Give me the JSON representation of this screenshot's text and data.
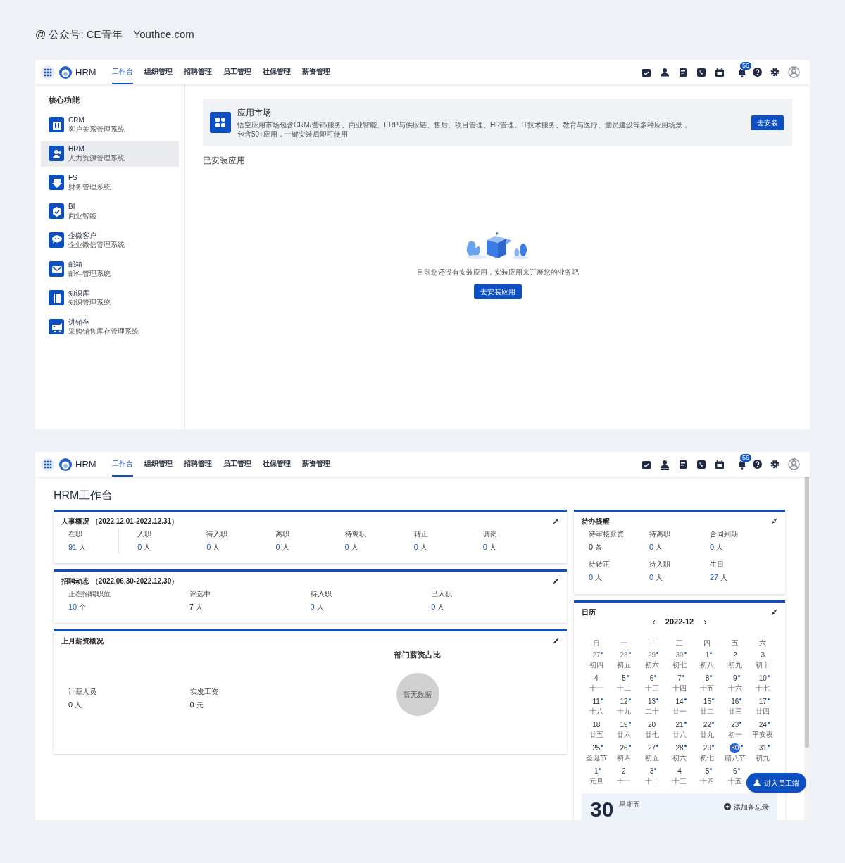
{
  "credit": [
    "@ 公众号: CE青年",
    "Youthce.com"
  ],
  "app_market_screen": {
    "nav": {
      "brand": "HRM",
      "tabs": [
        {
          "label": "工作台",
          "selected": true
        },
        {
          "label": "组织管理",
          "selected": false
        },
        {
          "label": "招聘管理",
          "selected": false
        },
        {
          "label": "员工管理",
          "selected": false
        },
        {
          "label": "社保管理",
          "selected": false
        },
        {
          "label": "薪资管理",
          "selected": false
        }
      ],
      "badge": "56"
    },
    "sidebar": {
      "heading": "核心功能",
      "items": [
        {
          "name": "CRM",
          "desc": "客户关系管理系统",
          "selected": false
        },
        {
          "name": "HRM",
          "desc": "人力资源管理系统",
          "selected": true
        },
        {
          "name": "FS",
          "desc": "财务管理系统",
          "selected": false
        },
        {
          "name": "BI",
          "desc": "商业智能",
          "selected": false
        },
        {
          "name": "企微客户",
          "desc": "企业微信管理系统",
          "selected": false
        },
        {
          "name": "邮箱",
          "desc": "邮件管理系统",
          "selected": false
        },
        {
          "name": "知识库",
          "desc": "知识管理系统",
          "selected": false
        },
        {
          "name": "进销存",
          "desc": "采购销售库存管理系统",
          "selected": false
        }
      ]
    },
    "market": {
      "title": "应用市场",
      "lines": [
        "悟空应用市场包含CRM/营销/服务、商业智能、ERP与供应链、售后、项目管理、HR管理、IT技术服务、教育与医疗、党员建设等多种应用场景，",
        "包含50+应用，一键安装后即可使用"
      ],
      "button": "去安装"
    },
    "installed": {
      "heading": "已安装应用",
      "empty_text": "目前您还没有安装应用，安装应用来开展您的业务吧",
      "button": "去安装应用"
    }
  },
  "workbench_screen": {
    "nav": {
      "brand": "HRM",
      "tabs": [
        {
          "label": "工作台",
          "selected": true
        },
        {
          "label": "组织管理",
          "selected": false
        },
        {
          "label": "招聘管理",
          "selected": false
        },
        {
          "label": "员工管理",
          "selected": false
        },
        {
          "label": "社保管理",
          "selected": false
        },
        {
          "label": "薪资管理",
          "selected": false
        }
      ],
      "badge": "56"
    },
    "title": "HRM工作台",
    "personnel": {
      "title": "人事概况 （2022.12.01-2022.12.31）",
      "stats": [
        {
          "label": "在职",
          "value": "91",
          "unit": "人",
          "accent": true
        },
        {
          "label": "入职",
          "value": "0",
          "unit": "人",
          "accent": true
        },
        {
          "label": "待入职",
          "value": "0",
          "unit": "人",
          "accent": true
        },
        {
          "label": "离职",
          "value": "0",
          "unit": "人",
          "accent": true
        },
        {
          "label": "待离职",
          "value": "0",
          "unit": "人",
          "accent": true
        },
        {
          "label": "转正",
          "value": "0",
          "unit": "人",
          "accent": true
        },
        {
          "label": "调岗",
          "value": "0",
          "unit": "人",
          "accent": true
        }
      ]
    },
    "recruiting": {
      "title": "招聘动态 （2022.06.30-2022.12.30）",
      "stats": [
        {
          "label": "正在招聘职位",
          "value": "10",
          "unit": "个",
          "accent": true
        },
        {
          "label": "评选中",
          "value": "7",
          "unit": "人",
          "accent": false
        },
        {
          "label": "待入职",
          "value": "0",
          "unit": "人",
          "accent": true
        },
        {
          "label": "已入职",
          "value": "0",
          "unit": "人",
          "accent": true
        }
      ]
    },
    "salary": {
      "title": "上月薪资概况",
      "stats": [
        {
          "label": "计薪人员",
          "value": "0",
          "unit": "人",
          "accent": false
        },
        {
          "label": "实发工资",
          "value": "0",
          "unit": "元",
          "accent": false
        }
      ],
      "chart_title": "部门薪资占比",
      "no_data": "暂无数据"
    },
    "todo": {
      "title": "待办提醒",
      "stats": [
        {
          "label": "待审核薪资",
          "value": "0",
          "unit": "条",
          "accent": false
        },
        {
          "label": "待离职",
          "value": "0",
          "unit": "人",
          "accent": true
        },
        {
          "label": "合同到期",
          "value": "0",
          "unit": "人",
          "accent": true
        },
        {
          "label": "待转正",
          "value": "0",
          "unit": "人",
          "accent": true
        },
        {
          "label": "待入职",
          "value": "0",
          "unit": "人",
          "accent": true
        },
        {
          "label": "生日",
          "value": "27",
          "unit": "人",
          "accent": true
        }
      ]
    },
    "calendar": {
      "title": "日历",
      "prev": "‹",
      "month": "2022-12",
      "next": "›",
      "weekdays": [
        "日",
        "一",
        "二",
        "三",
        "四",
        "五",
        "六"
      ],
      "weeks": [
        [
          {
            "day": "27",
            "lunar": "初四",
            "dot": true,
            "muted": true,
            "selected": false
          },
          {
            "day": "28",
            "lunar": "初五",
            "dot": true,
            "muted": true,
            "selected": false
          },
          {
            "day": "29",
            "lunar": "初六",
            "dot": true,
            "muted": true,
            "selected": false
          },
          {
            "day": "30",
            "lunar": "初七",
            "dot": true,
            "muted": true,
            "selected": false
          },
          {
            "day": "1",
            "lunar": "初八",
            "dot": true,
            "muted": false,
            "selected": false
          },
          {
            "day": "2",
            "lunar": "初九",
            "dot": false,
            "muted": false,
            "selected": false
          },
          {
            "day": "3",
            "lunar": "初十",
            "dot": false,
            "muted": false,
            "selected": false
          }
        ],
        [
          {
            "day": "4",
            "lunar": "十一",
            "dot": false,
            "muted": false,
            "selected": false
          },
          {
            "day": "5",
            "lunar": "十二",
            "dot": true,
            "muted": false,
            "selected": false
          },
          {
            "day": "6",
            "lunar": "十三",
            "dot": true,
            "muted": false,
            "selected": false
          },
          {
            "day": "7",
            "lunar": "十四",
            "dot": true,
            "muted": false,
            "selected": false
          },
          {
            "day": "8",
            "lunar": "十五",
            "dot": true,
            "muted": false,
            "selected": false
          },
          {
            "day": "9",
            "lunar": "十六",
            "dot": true,
            "muted": false,
            "selected": false
          },
          {
            "day": "10",
            "lunar": "十七",
            "dot": true,
            "muted": false,
            "selected": false
          }
        ],
        [
          {
            "day": "11",
            "lunar": "十八",
            "dot": true,
            "muted": false,
            "selected": false
          },
          {
            "day": "12",
            "lunar": "十九",
            "dot": true,
            "muted": false,
            "selected": false
          },
          {
            "day": "13",
            "lunar": "二十",
            "dot": true,
            "muted": false,
            "selected": false
          },
          {
            "day": "14",
            "lunar": "廿一",
            "dot": true,
            "muted": false,
            "selected": false
          },
          {
            "day": "15",
            "lunar": "廿二",
            "dot": true,
            "muted": false,
            "selected": false
          },
          {
            "day": "16",
            "lunar": "廿三",
            "dot": true,
            "muted": false,
            "selected": false
          },
          {
            "day": "17",
            "lunar": "廿四",
            "dot": true,
            "muted": false,
            "selected": false
          }
        ],
        [
          {
            "day": "18",
            "lunar": "廿五",
            "dot": false,
            "muted": false,
            "selected": false
          },
          {
            "day": "19",
            "lunar": "廿六",
            "dot": true,
            "muted": false,
            "selected": false
          },
          {
            "day": "20",
            "lunar": "廿七",
            "dot": false,
            "muted": false,
            "selected": false
          },
          {
            "day": "21",
            "lunar": "廿八",
            "dot": true,
            "muted": false,
            "selected": false
          },
          {
            "day": "22",
            "lunar": "廿九",
            "dot": true,
            "muted": false,
            "selected": false
          },
          {
            "day": "23",
            "lunar": "初一",
            "dot": true,
            "muted": false,
            "selected": false
          },
          {
            "day": "24",
            "lunar": "平安夜",
            "dot": true,
            "muted": false,
            "selected": false
          }
        ],
        [
          {
            "day": "25",
            "lunar": "圣诞节",
            "dot": true,
            "muted": false,
            "selected": false
          },
          {
            "day": "26",
            "lunar": "初四",
            "dot": true,
            "muted": false,
            "selected": false
          },
          {
            "day": "27",
            "lunar": "初五",
            "dot": true,
            "muted": false,
            "selected": false
          },
          {
            "day": "28",
            "lunar": "初六",
            "dot": true,
            "muted": false,
            "selected": false
          },
          {
            "day": "29",
            "lunar": "初七",
            "dot": true,
            "muted": false,
            "selected": false
          },
          {
            "day": "30",
            "lunar": "腊八节",
            "dot": true,
            "muted": false,
            "selected": true
          },
          {
            "day": "31",
            "lunar": "初九",
            "dot": true,
            "muted": false,
            "selected": false
          }
        ],
        [
          {
            "day": "1",
            "lunar": "元旦",
            "dot": true,
            "muted": false,
            "selected": false
          },
          {
            "day": "2",
            "lunar": "十一",
            "dot": false,
            "muted": false,
            "selected": false
          },
          {
            "day": "3",
            "lunar": "十二",
            "dot": true,
            "muted": false,
            "selected": false
          },
          {
            "day": "4",
            "lunar": "十三",
            "dot": false,
            "muted": false,
            "selected": false
          },
          {
            "day": "5",
            "lunar": "十四",
            "dot": true,
            "muted": false,
            "selected": false
          },
          {
            "day": "6",
            "lunar": "十五",
            "dot": true,
            "muted": false,
            "selected": false
          }
        ]
      ],
      "today_big": "30",
      "today_weekday": "星期五",
      "add_memo": "添加备忘录"
    },
    "float_button": "进入员工端"
  }
}
